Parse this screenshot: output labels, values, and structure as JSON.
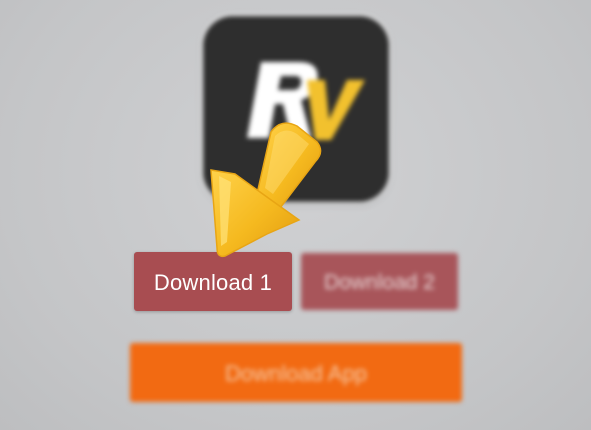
{
  "app": {
    "logo_text": "Rv",
    "logo_bg_color": "#2e2e2e",
    "logo_accent_color": "#f2c12e"
  },
  "buttons": {
    "download1_label": "Download 1",
    "download2_label": "Download 2",
    "download_app_label": "Download App"
  },
  "colors": {
    "download1": "#a84d51",
    "download2": "#a8555a",
    "download_app": "#f26a12",
    "arrow": "#f5b91f"
  },
  "icons": {
    "arrow": "arrow-down-left-icon"
  }
}
